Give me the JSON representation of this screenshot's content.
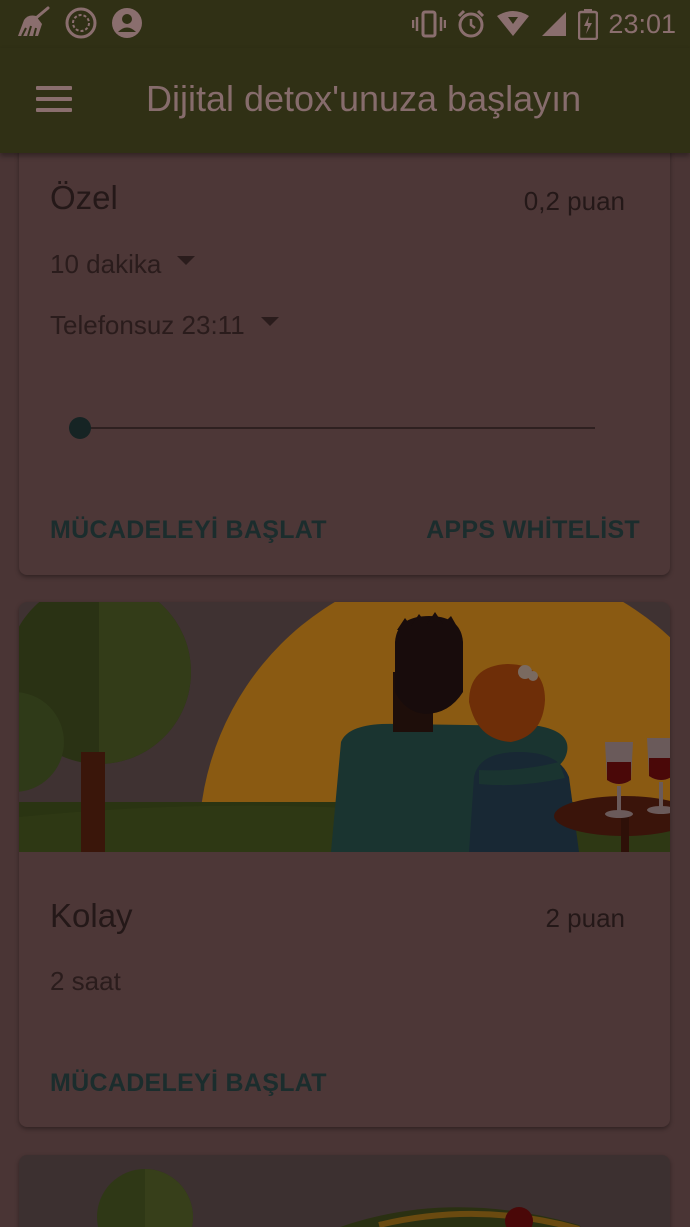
{
  "status_bar": {
    "time": "23:01",
    "left_icons": [
      "cleaner-icon",
      "compass-icon",
      "profile-icon"
    ],
    "right_icons": [
      "vibrate-icon",
      "alarm-icon",
      "wifi-icon",
      "signal-icon",
      "battery-charging-icon"
    ]
  },
  "app_bar": {
    "menu_icon": "menu-icon",
    "title": "Dijital detox'unuza başlayın"
  },
  "cards": [
    {
      "title": "Özel",
      "points": "0,2 puan",
      "duration": "10 dakika",
      "until": "Telefonsuz 23:11",
      "slider_value": 0,
      "start_button": "MÜCADELEYİ BAŞLAT",
      "whitelist_button": "APPS WHİTELİST"
    },
    {
      "title": "Kolay",
      "points": "2 puan",
      "duration": "2 saat",
      "start_button": "MÜCADELEYİ BAŞLAT"
    }
  ],
  "colors": {
    "overlay_background": "#4a3535",
    "bar_background": "#303015",
    "accent_text": "#1b2d2d"
  }
}
